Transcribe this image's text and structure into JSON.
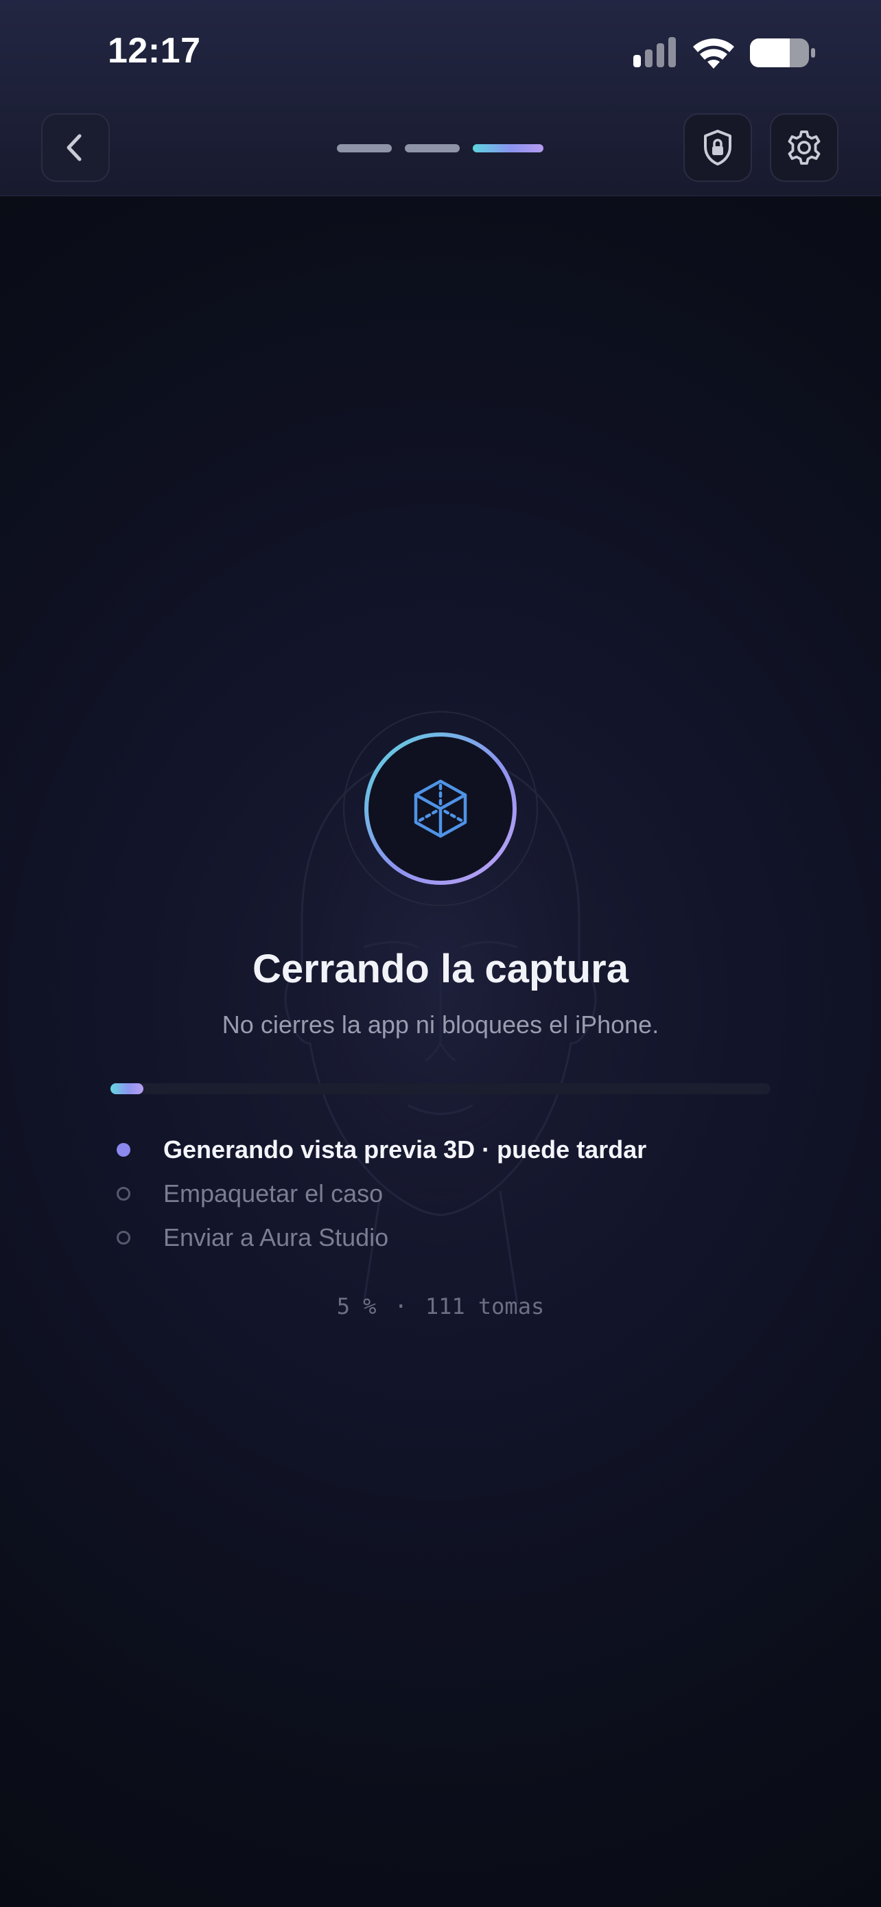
{
  "status_bar": {
    "time": "12:17",
    "signal_icon": "cellular-signal-icon",
    "wifi_icon": "wifi-icon",
    "battery_icon": "battery-icon",
    "battery_level": 0.6
  },
  "header": {
    "back_icon": "chevron-left-icon",
    "security_icon": "shield-lock-icon",
    "settings_icon": "gear-icon",
    "steps_total": 3,
    "steps_current": 3
  },
  "main": {
    "status_icon": "cube-3d-icon",
    "title": "Cerrando la captura",
    "subtitle": "No cierres la app ni bloquees el iPhone.",
    "progress_fraction": 0.05,
    "tasks": [
      {
        "label": "Generando vista previa 3D · puede tardar",
        "state": "active"
      },
      {
        "label": "Empaquetar el caso",
        "state": "pending"
      },
      {
        "label": "Enviar a Aura Studio",
        "state": "pending"
      }
    ],
    "percent": "5 %",
    "separator": "·",
    "shots": "111 tomas"
  },
  "colors": {
    "accent_cyan": "#5ed4de",
    "accent_violet": "#8c93f0",
    "accent_lilac": "#b59cf0",
    "active_dot": "#8b88ee",
    "background": "#0c0f1c"
  }
}
